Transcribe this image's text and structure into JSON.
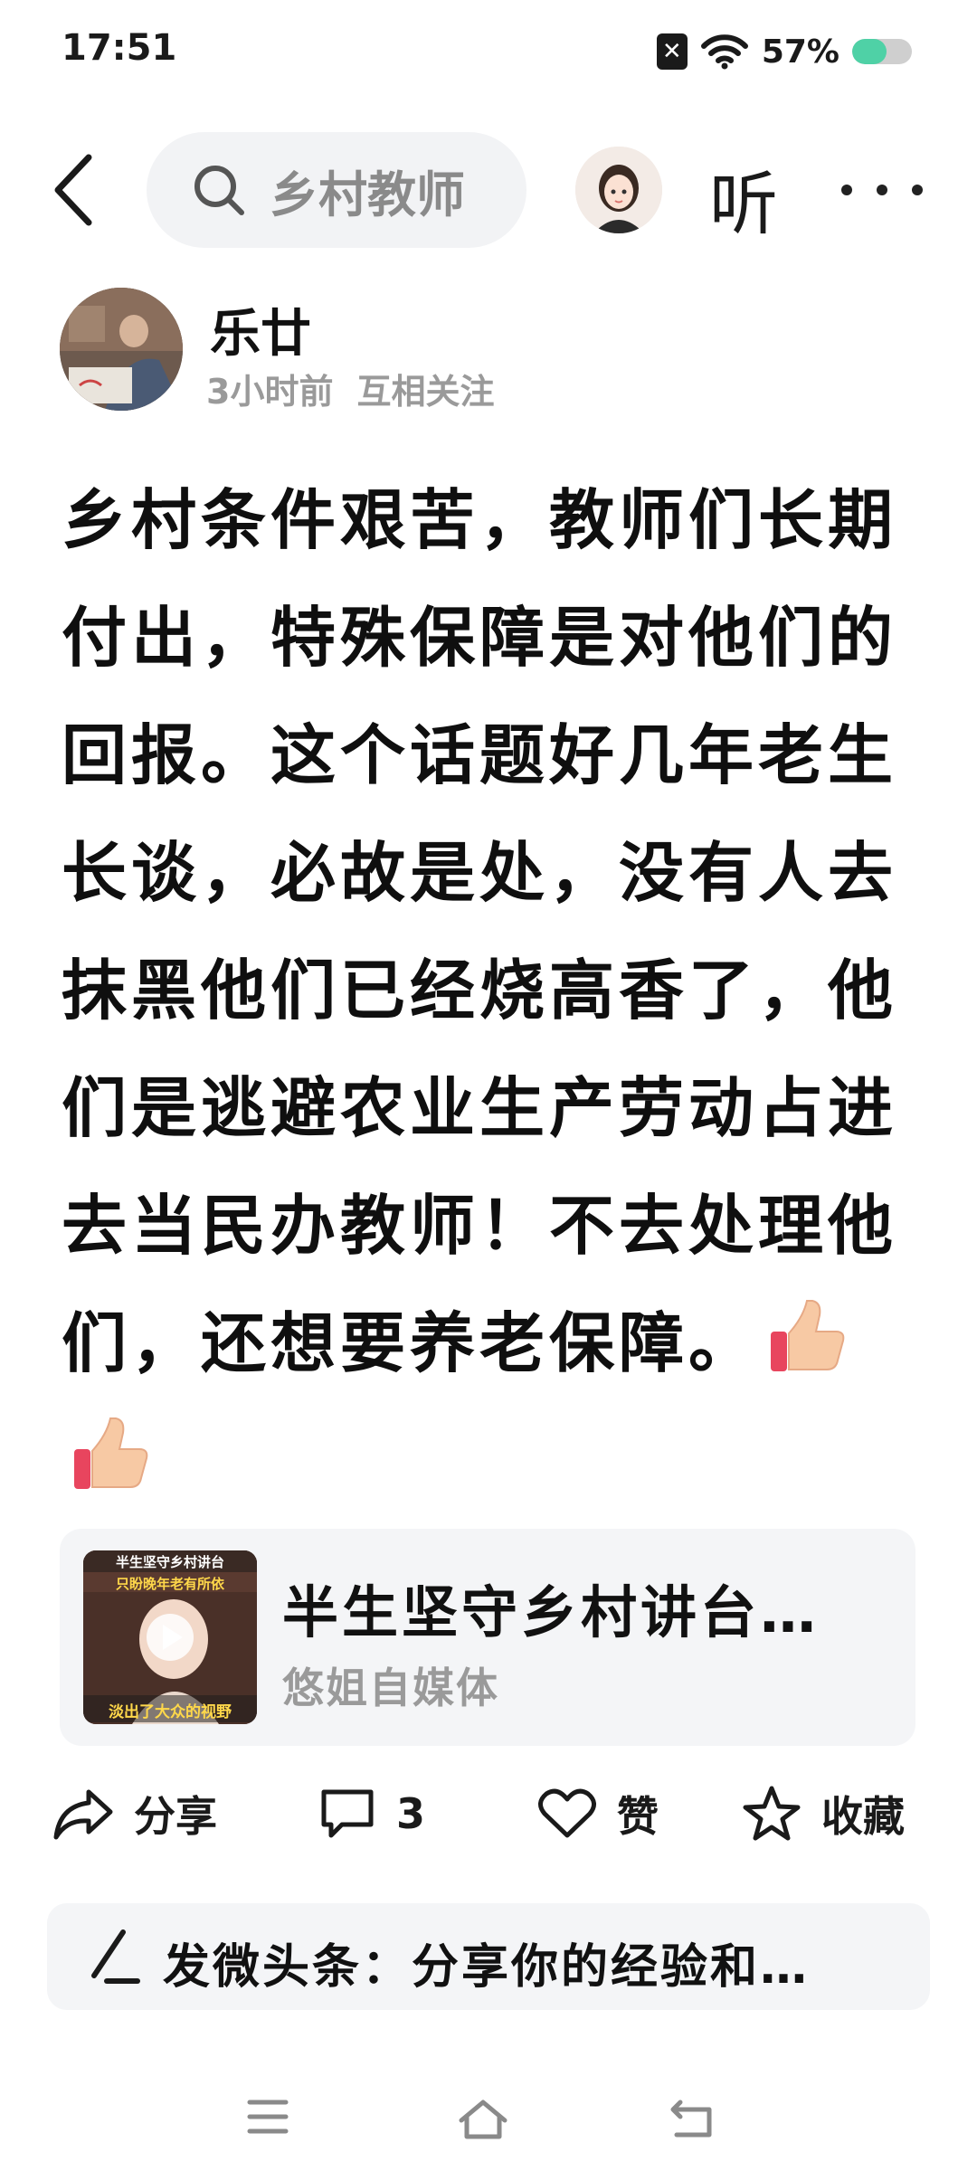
{
  "status_bar": {
    "time": "17:51",
    "battery_percent": "57%",
    "battery_level": 0.57,
    "icons": [
      "sim-blocked-icon",
      "wifi-icon",
      "battery-icon"
    ]
  },
  "nav": {
    "search_text": "乡村教师",
    "listen_label": "听",
    "icons": [
      "back-chevron-icon",
      "search-icon",
      "avatar",
      "more-dots-icon"
    ]
  },
  "author": {
    "name": "乐廿",
    "time_ago": "3小时前",
    "relation": "互相关注"
  },
  "post": {
    "text": "乡村条件艰苦，教师们长期付出，特殊保障是对他们的回报。这个话题好几年老生长谈，必故是处，没有人去抹黑他们已经烧高香了，他们是逃避农业生产劳动占进去当民办教师！不去处理他们，还想要养老保障。",
    "emoji": [
      "thumbs-up-icon",
      "thumbs-up-icon"
    ]
  },
  "linked_card": {
    "title": "半生坚守乡村讲台…",
    "source": "悠姐自媒体",
    "thumb_caption_top": "半生坚守乡村讲台",
    "thumb_caption_mid": "只盼晚年老有所依",
    "thumb_caption_bottom": "淡出了大众的视野"
  },
  "actions": {
    "share_label": "分享",
    "comment_count": "3",
    "like_label": "赞",
    "favorite_label": "收藏"
  },
  "compose": {
    "placeholder": "发微头条：分享你的经验和…"
  },
  "colors": {
    "battery_fill": "#4fd1a6",
    "search_bg": "#f2f3f5",
    "card_bg": "#f4f5f7",
    "meta_gray": "#9a9a9a"
  }
}
